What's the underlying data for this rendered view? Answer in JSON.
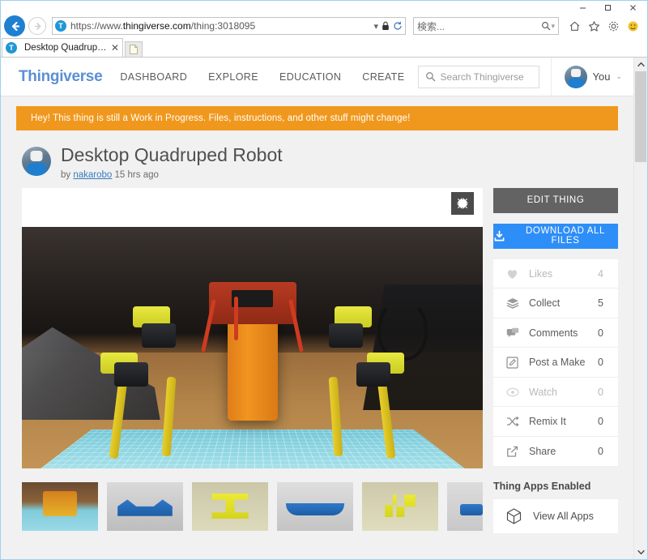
{
  "browser": {
    "window_controls": {
      "minimize": "–",
      "maximize": "□",
      "close": "✕"
    },
    "back_label": "Back",
    "forward_label": "Forward",
    "site_badge": "T",
    "url_scheme": "https://www.",
    "url_domain": "thingiverse.com",
    "url_path": "/thing:3018095",
    "url_full": "https://www.thingiverse.com/thing:3018095",
    "refresh_label": "Refresh",
    "lock_label": "Secure",
    "search_placeholder": "検索...",
    "toolbar_icons": [
      "home-icon",
      "favorites-star-icon",
      "tools-gear-icon",
      "smiley-feedback-icon"
    ],
    "tab_title": "Desktop Quadruped Robot ...",
    "tab_close": "✕",
    "new_tab_label": "New tab"
  },
  "site_header": {
    "logo": "Thingiverse",
    "logo_color": "#5b8fd4",
    "nav": [
      {
        "label": "DASHBOARD"
      },
      {
        "label": "EXPLORE"
      },
      {
        "label": "EDUCATION"
      },
      {
        "label": "CREATE"
      }
    ],
    "search_placeholder": "Search Thingiverse",
    "user_label": "You",
    "user_caret": "⌄"
  },
  "banner": {
    "text": "Hey! This thing is still a Work in Progress. Files, instructions, and other stuff might change!",
    "color": "#f0981d"
  },
  "thing": {
    "title": "Desktop Quadruped Robot",
    "by_prefix": "by",
    "author": "nakarobo",
    "posted": "15 hrs ago",
    "expand_label": "Expand image"
  },
  "gallery": {
    "thumbnails": [
      {
        "name": "thumbnail-1-assembled-robot"
      },
      {
        "name": "thumbnail-2-blue-frame-part"
      },
      {
        "name": "thumbnail-3-yellow-bracket-print"
      },
      {
        "name": "thumbnail-4-blue-curved-part"
      },
      {
        "name": "thumbnail-5-yellow-leg-print"
      },
      {
        "name": "thumbnail-6-blue-part-partial"
      }
    ]
  },
  "sidebar": {
    "edit_label": "EDIT THING",
    "download_label": "DOWNLOAD ALL FILES",
    "download_color": "#2e8ef7",
    "stats": [
      {
        "icon": "heart-icon",
        "label": "Likes",
        "value": "4",
        "dim": true
      },
      {
        "icon": "layers-icon",
        "label": "Collect",
        "value": "5",
        "dim": false
      },
      {
        "icon": "comment-icon",
        "label": "Comments",
        "value": "0",
        "dim": false
      },
      {
        "icon": "pencil-square-icon",
        "label": "Post a Make",
        "value": "0",
        "dim": false
      },
      {
        "icon": "eye-icon",
        "label": "Watch",
        "value": "0",
        "dim": true
      },
      {
        "icon": "shuffle-icon",
        "label": "Remix It",
        "value": "0",
        "dim": false
      },
      {
        "icon": "share-icon",
        "label": "Share",
        "value": "0",
        "dim": false
      }
    ],
    "apps_title": "Thing Apps Enabled",
    "apps_item": "View All Apps"
  }
}
